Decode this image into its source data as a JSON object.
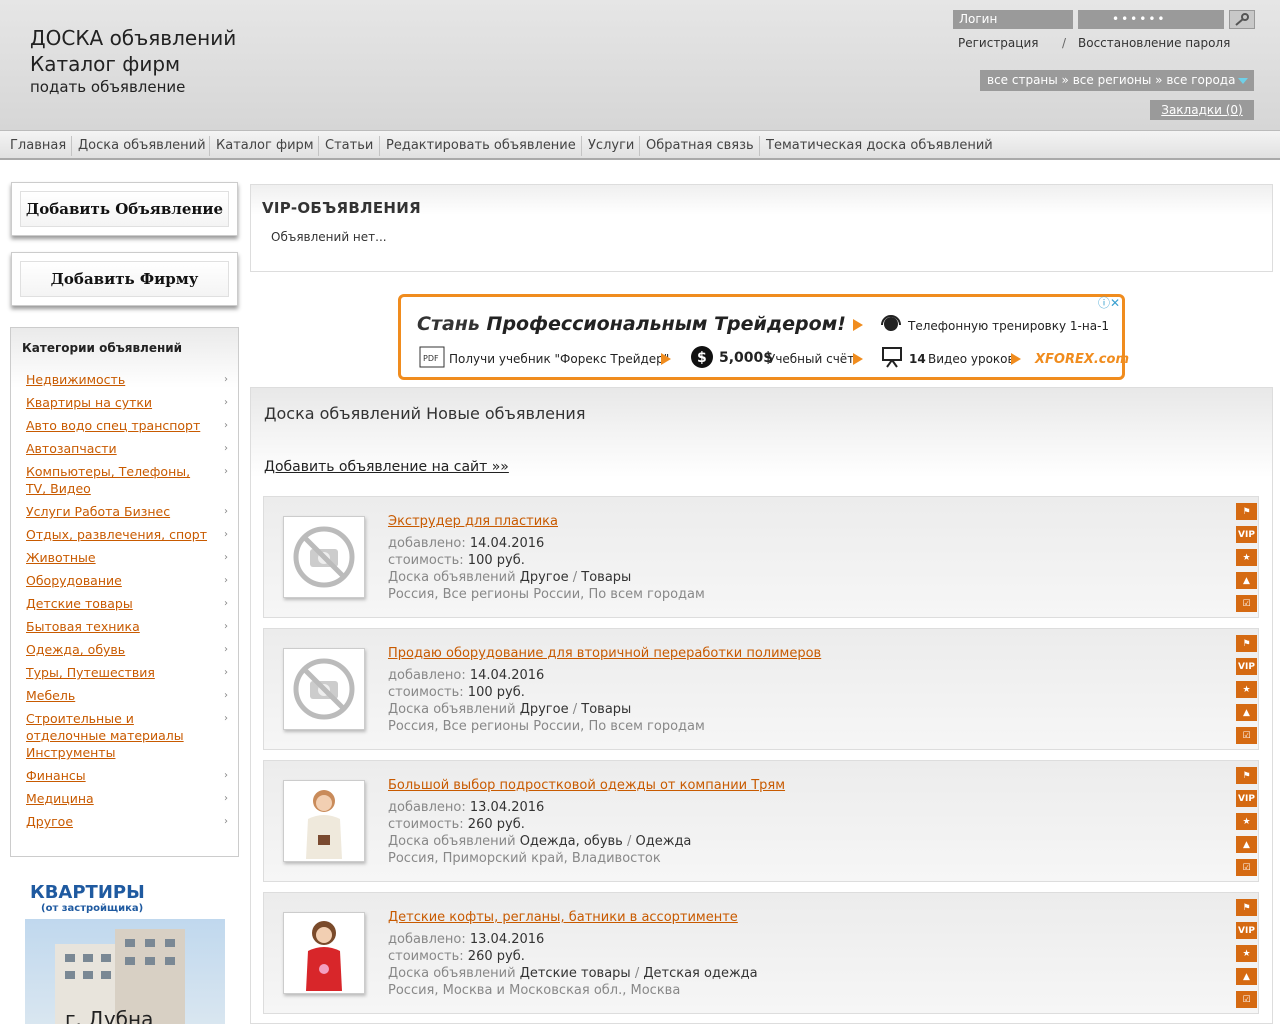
{
  "brand": {
    "line1": "ДОСКА объявлений",
    "line2": "Каталог фирм",
    "line3": "подать объявление"
  },
  "auth": {
    "login_placeholder": "Логин",
    "password_mask": "••••••",
    "register": "Регистрация",
    "separator": "/",
    "restore": "Восстановление пароля"
  },
  "region": {
    "label": "все страны » все регионы » все города"
  },
  "bookmarks": {
    "label": "Закладки (0)"
  },
  "nav": [
    "Главная",
    "Доска объявлений",
    "Каталог фирм",
    "Статьи",
    "Редактировать объявление",
    "Услуги",
    "Обратная связь",
    "Тематическая доска объявлений"
  ],
  "sidebar": {
    "add_ad": "Добавить Объявление",
    "add_firm": "Добавить Фирму",
    "categories_title": "Категории объявлений",
    "categories": [
      "Недвижимость",
      "Квартиры на сутки",
      "Авто водо спец транспорт",
      "Автозапчасти",
      "Компьютеры, Телефоны, TV, Видео",
      "Услуги Работа Бизнес",
      "Отдых, развлечения, спорт",
      "Животные",
      "Оборудование",
      "Детские товары",
      "Бытовая техника",
      "Одежда, обувь",
      "Туры, Путешествия",
      "Мебель",
      "Строительные и отделочные материалы Инструменты",
      "Финансы",
      "Медицина",
      "Другое"
    ],
    "ad": {
      "title": "КВАРТИРЫ",
      "subtitle": "(от застройщика)",
      "city": "г. Дубна"
    }
  },
  "vip": {
    "title": "VIP-ОБЪЯВЛЕНИЯ",
    "empty": "Объявлений нет..."
  },
  "banner": {
    "headline_prefix": "Стань ",
    "headline": "Профессиональным Трейдером!",
    "item1": "Телефонную тренировку 1-на-1",
    "item2": "Получи учебник \"Форекс Трейдер\"",
    "item3_amount": "5,000$",
    "item3": "Учебный счёт",
    "item4_num": "14",
    "item4": "Видео уроков",
    "brand": "XFOREX.com"
  },
  "main": {
    "title": "Доска объявлений Новые объявления",
    "add_link": "Добавить объявление на сайт »»"
  },
  "labels": {
    "added": "добавлено:",
    "price": "стоимость:",
    "board": "Доска объявлений",
    "slash": "/"
  },
  "listings": [
    {
      "title": "Экструдер для пластика",
      "date": "14.04.2016",
      "price": "100 руб.",
      "cat1": "Другое",
      "cat2": "Товары",
      "location": "Россия, Все регионы России, По всем городам",
      "thumb": "no-photo"
    },
    {
      "title": "Продаю оборудование для вторичной переработки полимеров",
      "date": "14.04.2016",
      "price": "100 руб.",
      "cat1": "Другое",
      "cat2": "Товары",
      "location": "Россия, Все регионы России, По всем городам",
      "thumb": "no-photo"
    },
    {
      "title": "Большой выбор подростковой одежды от компании Трям",
      "date": "13.04.2016",
      "price": "260 руб.",
      "cat1": "Одежда, обувь",
      "cat2": "Одежда",
      "location": "Россия, Приморский край, Владивосток",
      "thumb": "girl-white"
    },
    {
      "title": "Детские кофты, регланы, батники в ассортименте",
      "date": "13.04.2016",
      "price": "260 руб.",
      "cat1": "Детские товары",
      "cat2": "Детская одежда",
      "location": "Россия, Москва и Московская обл., Москва",
      "thumb": "girl-red"
    }
  ],
  "colors": {
    "accent": "#c85a00",
    "icon_bg": "#d56a12",
    "banner_border": "#f08c1e"
  }
}
